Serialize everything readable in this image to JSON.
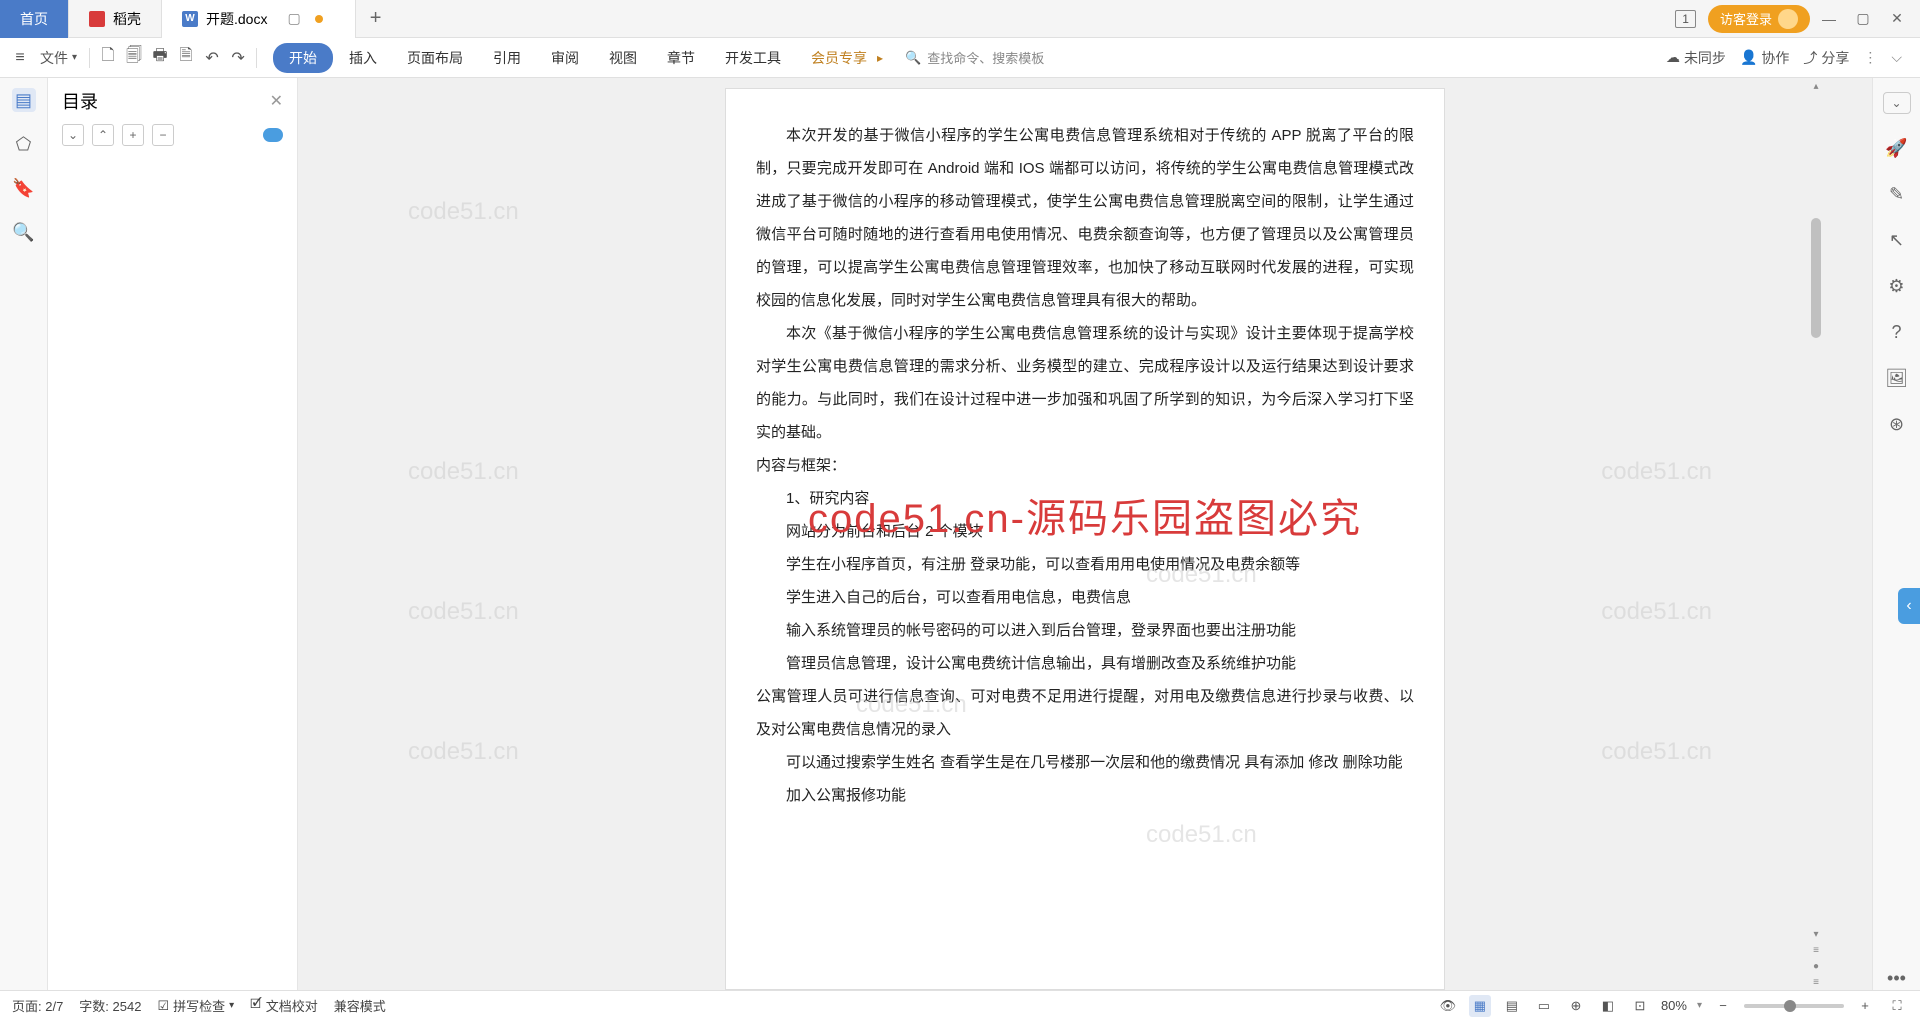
{
  "tabs": {
    "home": "首页",
    "daoke": "稻壳",
    "document": "开题.docx"
  },
  "window": {
    "badge": "1",
    "login": "访客登录"
  },
  "toolbar": {
    "file": "文件"
  },
  "menu": {
    "start": "开始",
    "insert": "插入",
    "layout": "页面布局",
    "reference": "引用",
    "review": "审阅",
    "view": "视图",
    "chapter": "章节",
    "devtools": "开发工具",
    "vip": "会员专享"
  },
  "search": {
    "placeholder": "查找命令、搜索模板"
  },
  "toolbarRight": {
    "unsync": "未同步",
    "collab": "协作",
    "share": "分享"
  },
  "outline": {
    "title": "目录"
  },
  "doc": {
    "p1": "本次开发的基于微信小程序的学生公寓电费信息管理系统相对于传统的 APP 脱离了平台的限制，只要完成开发即可在 Android 端和 IOS 端都可以访问，将传统的学生公寓电费信息管理模式改进成了基于微信的小程序的移动管理模式，使学生公寓电费信息管理脱离空间的限制，让学生通过微信平台可随时随地的进行查看用电使用情况、电费余额查询等，也方便了管理员以及公寓管理员的管理，可以提高学生公寓电费信息管理管理效率，也加快了移动互联网时代发展的进程，可实现校园的信息化发展，同时对学生公寓电费信息管理具有很大的帮助。",
    "p2": "本次《基于微信小程序的学生公寓电费信息管理系统的设计与实现》设计主要体现于提高学校对学生公寓电费信息管理的需求分析、业务模型的建立、完成程序设计以及运行结果达到设计要求的能力。与此同时，我们在设计过程中进一步加强和巩固了所学到的知识，为今后深入学习打下坚实的基础。",
    "h1": "内容与框架：",
    "h2": "1、研究内容",
    "l1": "网站分为前台和后台 2 个模块",
    "l2": "学生在小程序首页，有注册 登录功能，可以查看用用电使用情况及电费余额等",
    "l3": "学生进入自己的后台，可以查看用电信息，电费信息",
    "l4": "输入系统管理员的帐号密码的可以进入到后台管理，登录界面也要出注册功能",
    "l5": "管理员信息管理，设计公寓电费统计信息输出，具有增删改查及系统维护功能",
    "l6": "公寓管理人员可进行信息查询、可对电费不足用进行提醒，对用电及缴费信息进行抄录与收费、以及对公寓电费信息情况的录入",
    "l7": "可以通过搜索学生姓名 查看学生是在几号楼那一次层和他的缴费情况  具有添加 修改 删除功能",
    "l8": "加入公寓报修功能"
  },
  "watermark": {
    "small": "code51.cn",
    "big": "code51.cn-源码乐园盗图必究"
  },
  "status": {
    "page": "页面: 2/7",
    "words": "字数: 2542",
    "spell": "拼写检查",
    "proof": "文档校对",
    "compat": "兼容模式",
    "zoom": "80%"
  }
}
